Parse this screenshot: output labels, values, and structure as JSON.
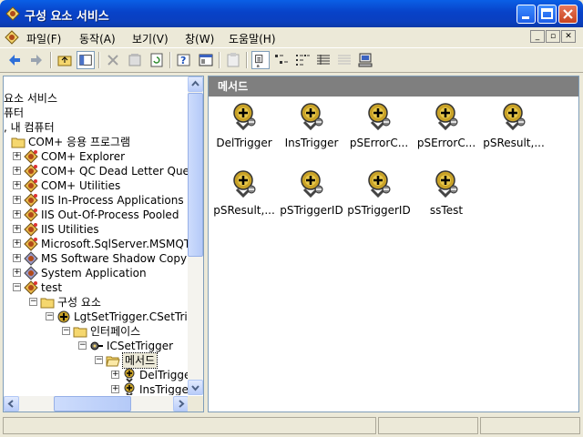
{
  "window": {
    "title": "구성 요소 서비스"
  },
  "menu": {
    "items": [
      "파일(F)",
      "동작(A)",
      "보기(V)",
      "창(W)",
      "도움말(H)"
    ]
  },
  "toolbar": {
    "icons": [
      "back-icon",
      "forward-icon",
      "up-folder-icon",
      "show-tree-icon",
      "delete-icon",
      "properties-icon",
      "refresh-icon",
      "help-icon",
      "console-icon",
      "export-icon",
      "large-icons-icon",
      "small-icons-icon",
      "list-icon",
      "details-icon",
      "disabled-icon",
      "computer-icon"
    ]
  },
  "tree": {
    "rows": [
      {
        "label": "요소 서비스"
      },
      {
        "label": "퓨터"
      },
      {
        "label": ", 내 컴퓨터"
      },
      {
        "label": "COM+ 응용 프로그램"
      },
      {
        "label": "COM+ Explorer"
      },
      {
        "label": "COM+ QC Dead Letter Queue"
      },
      {
        "label": "COM+ Utilities"
      },
      {
        "label": "IIS In-Process Applications"
      },
      {
        "label": "IIS Out-Of-Process Pooled"
      },
      {
        "label": "IIS Utilities"
      },
      {
        "label": "Microsoft.SqlServer.MSMQTask"
      },
      {
        "label": "MS Software Shadow Copy"
      },
      {
        "label": "System Application"
      },
      {
        "label": "test"
      },
      {
        "label": "구성 요소"
      },
      {
        "label": "LgtSetTrigger.CSetTrigger"
      },
      {
        "label": "인터페이스"
      },
      {
        "label": "ICSetTrigger"
      },
      {
        "label": "메서드"
      },
      {
        "label": "DelTrigger"
      },
      {
        "label": "InsTrigger"
      }
    ]
  },
  "content": {
    "header": "메서드",
    "items": [
      {
        "label": "DelTrigger"
      },
      {
        "label": "InsTrigger"
      },
      {
        "label": "pSErrorC..."
      },
      {
        "label": "pSErrorC..."
      },
      {
        "label": "pSResult,..."
      },
      {
        "label": "pSResult,..."
      },
      {
        "label": "pSTriggerID"
      },
      {
        "label": "pSTriggerID"
      },
      {
        "label": "ssTest"
      }
    ]
  }
}
